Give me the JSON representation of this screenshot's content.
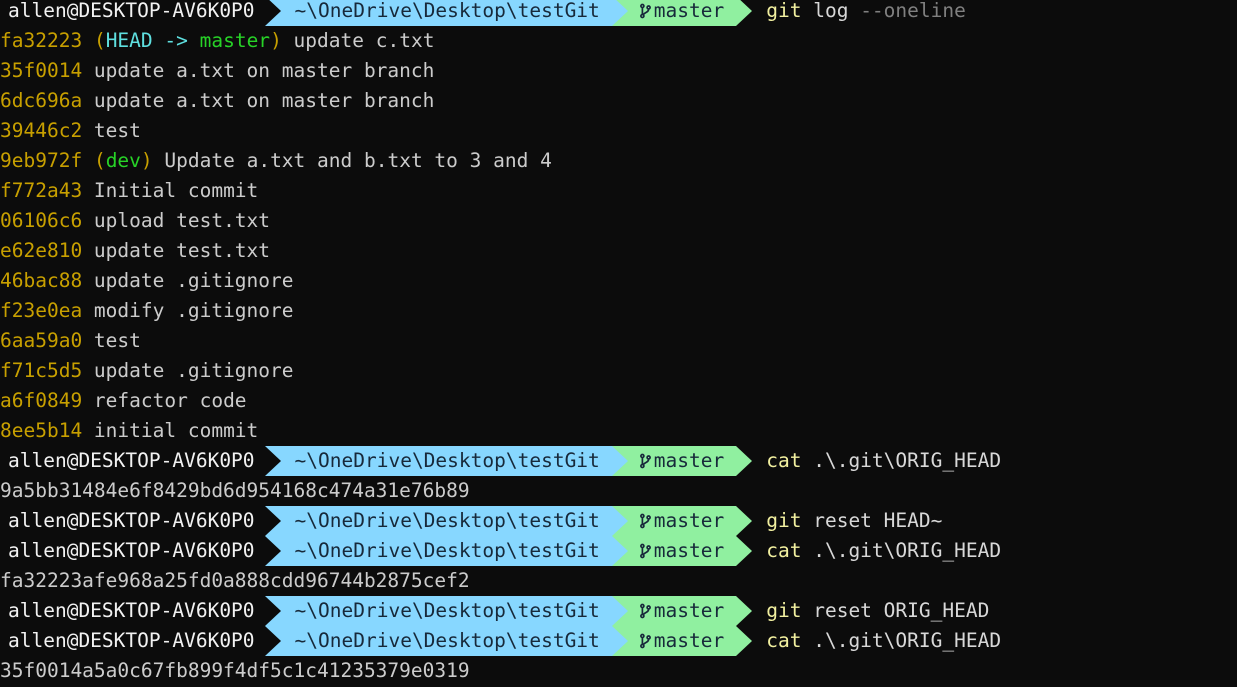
{
  "terminal": {
    "background": "#0c0c0c",
    "prompt": {
      "user_host": "allen@DESKTOP-AV6K0P0",
      "path": "~\\OneDrive\\Desktop\\testGit",
      "branch": "master",
      "branch_glyph": "git-branch-icon",
      "colors": {
        "path_bg": "#87d7ff",
        "branch_bg": "#90f0a0",
        "segment_text": "#17293a",
        "user_text": "#f2f2f2"
      }
    },
    "commands": {
      "git_log": {
        "cmd": "git",
        "args": " log ",
        "flag": "--oneline"
      },
      "cat_orig_head": {
        "cmd": "cat",
        "args": " .\\.git\\ORIG_HEAD"
      },
      "git_reset_head_tilde": {
        "cmd": "git",
        "args": " reset HEAD~"
      },
      "git_reset_orig_head": {
        "cmd": "git",
        "args": " reset ORIG_HEAD"
      }
    },
    "log_entries": [
      {
        "hash": "fa32223",
        "decoration": true,
        "open_paren": "(",
        "head": "HEAD -> ",
        "ref": "master",
        "close_paren": ")",
        "message": " update c.txt"
      },
      {
        "hash": "35f0014",
        "decoration": false,
        "message": " update a.txt on master branch"
      },
      {
        "hash": "6dc696a",
        "decoration": false,
        "message": " update a.txt on master branch"
      },
      {
        "hash": "39446c2",
        "decoration": false,
        "message": " test"
      },
      {
        "hash": "9eb972f",
        "decoration": true,
        "open_paren": "(",
        "head": "",
        "ref": "dev",
        "close_paren": ")",
        "message": " Update a.txt and b.txt to 3 and 4"
      },
      {
        "hash": "f772a43",
        "decoration": false,
        "message": " Initial commit"
      },
      {
        "hash": "06106c6",
        "decoration": false,
        "message": " upload test.txt"
      },
      {
        "hash": "e62e810",
        "decoration": false,
        "message": " update test.txt"
      },
      {
        "hash": "46bac88",
        "decoration": false,
        "message": " update .gitignore"
      },
      {
        "hash": "f23e0ea",
        "decoration": false,
        "message": " modify .gitignore"
      },
      {
        "hash": "6aa59a0",
        "decoration": false,
        "message": " test"
      },
      {
        "hash": "f71c5d5",
        "decoration": false,
        "message": " update .gitignore"
      },
      {
        "hash": "a6f0849",
        "decoration": false,
        "message": " refactor code"
      },
      {
        "hash": "8ee5b14",
        "decoration": false,
        "message": " initial commit"
      }
    ],
    "outputs": {
      "orig_head_1": "9a5bb31484e6f8429bd6d954168c474a31e76b89",
      "orig_head_2": "fa32223afe968a25fd0a888cdd96744b2875cef2",
      "orig_head_3": "35f0014a5a0c67fb899f4df5c1c41235379e0319"
    }
  }
}
